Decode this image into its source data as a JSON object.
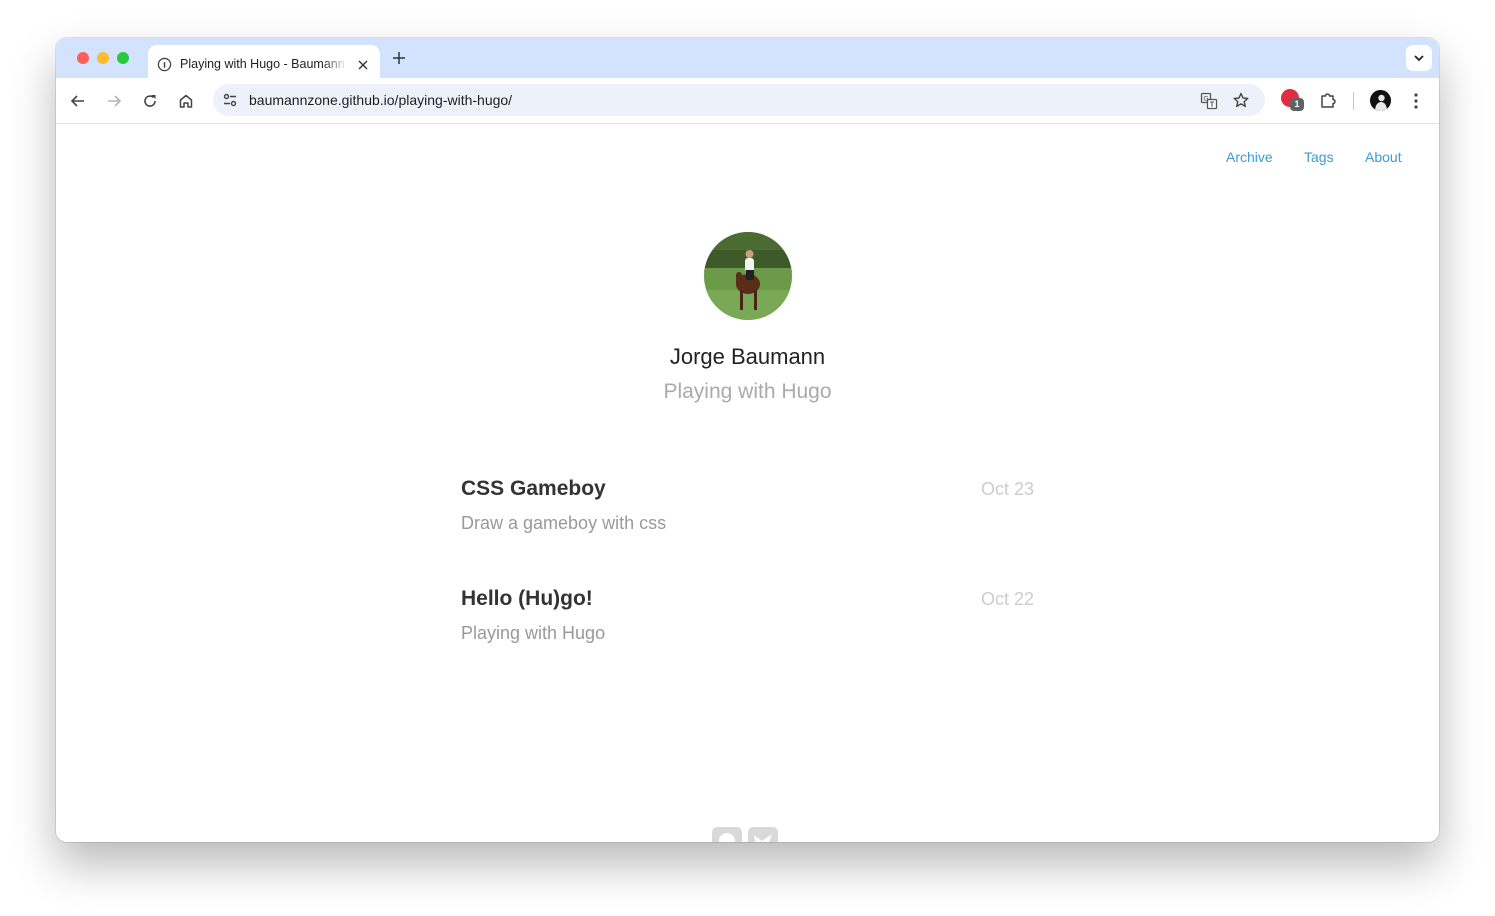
{
  "browser": {
    "tab": {
      "title": "Playing with Hugo - Baumann",
      "favicon": "globe-icon"
    },
    "address_bar": {
      "url": "baumannzone.github.io/playing-with-hugo/"
    },
    "extension_badge_count": "1",
    "colors": {
      "tabbar": "#d3e3fd",
      "omnibox": "#edf2fa"
    }
  },
  "nav": {
    "items": [
      {
        "label": "Archive"
      },
      {
        "label": "Tags"
      },
      {
        "label": "About"
      }
    ]
  },
  "profile": {
    "author": "Jorge Baumann",
    "subtitle": "Playing with Hugo"
  },
  "posts": [
    {
      "title": "CSS Gameboy",
      "date": "Oct 23",
      "description": "Draw a gameboy with css"
    },
    {
      "title": "Hello (Hu)go!",
      "date": "Oct 22",
      "description": "Playing with Hugo"
    }
  ],
  "footer": {
    "icons": [
      "github-icon",
      "twitter-icon"
    ]
  },
  "colors": {
    "link": "#3d9ad6",
    "title": "#333333",
    "muted": "#999999",
    "date": "#cccccc"
  }
}
